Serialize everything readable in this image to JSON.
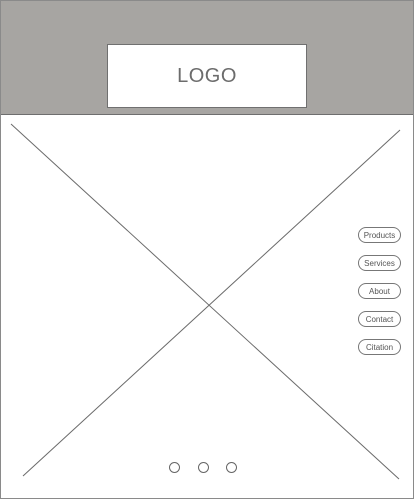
{
  "header": {
    "background_color": "#a7a5a2",
    "logo_text": "LOGO"
  },
  "hero": {
    "placeholder": "image-placeholder-x"
  },
  "nav": {
    "items": [
      {
        "label": "Products"
      },
      {
        "label": "Services"
      },
      {
        "label": "About"
      },
      {
        "label": "Contact"
      },
      {
        "label": "Citation"
      }
    ]
  },
  "carousel": {
    "dots": 3
  }
}
